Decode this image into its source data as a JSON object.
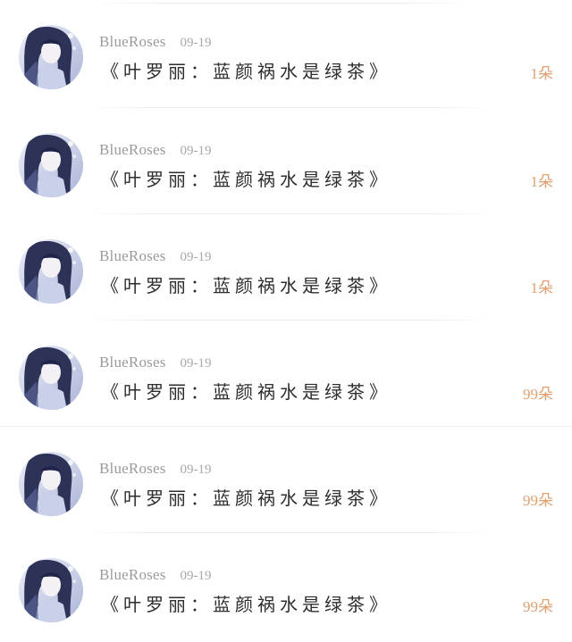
{
  "colors": {
    "username": "#9a9a9a",
    "date": "#a8a8a8",
    "title": "#2e2e2e",
    "flower_count": "#e0a070",
    "divider": "#ececec"
  },
  "items": [
    {
      "avatar_icon": "anime-girl-avatar",
      "username": "BlueRoses",
      "date": "09-19",
      "title": "《叶罗丽：蓝颜祸水是绿茶》",
      "count": "1朵"
    },
    {
      "avatar_icon": "anime-girl-avatar",
      "username": "BlueRoses",
      "date": "09-19",
      "title": "《叶罗丽：蓝颜祸水是绿茶》",
      "count": "1朵"
    },
    {
      "avatar_icon": "anime-girl-avatar",
      "username": "BlueRoses",
      "date": "09-19",
      "title": "《叶罗丽：蓝颜祸水是绿茶》",
      "count": "1朵"
    },
    {
      "avatar_icon": "anime-girl-avatar",
      "username": "BlueRoses",
      "date": "09-19",
      "title": "《叶罗丽：蓝颜祸水是绿茶》",
      "count": "99朵"
    },
    {
      "avatar_icon": "anime-girl-avatar",
      "username": "BlueRoses",
      "date": "09-19",
      "title": "《叶罗丽：蓝颜祸水是绿茶》",
      "count": "99朵"
    },
    {
      "avatar_icon": "anime-girl-avatar",
      "username": "BlueRoses",
      "date": "09-19",
      "title": "《叶罗丽：蓝颜祸水是绿茶》",
      "count": "99朵"
    }
  ]
}
